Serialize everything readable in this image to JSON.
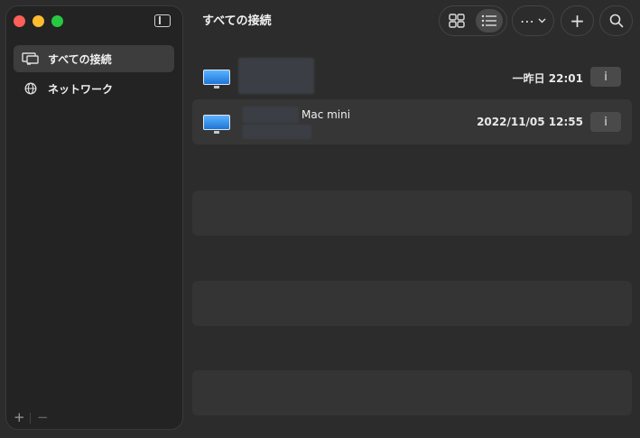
{
  "window": {
    "title": "すべての接続"
  },
  "sidebar": {
    "items": [
      {
        "label": "すべての接続",
        "icon": "display-icon",
        "active": true
      },
      {
        "label": "ネットワーク",
        "icon": "globe-icon",
        "active": false
      }
    ],
    "add_label": "+",
    "remove_label": "−"
  },
  "toolbar": {
    "grid_view": "grid-icon",
    "list_view": "list-icon",
    "more_label": "⋯",
    "add_label": "+",
    "search_icon": "search-icon"
  },
  "connections": [
    {
      "name": "",
      "time": "一昨日 22:01",
      "info_label": "i"
    },
    {
      "name": "Mac mini",
      "time": "2022/11/05 12:55",
      "info_label": "i"
    }
  ],
  "colors": {
    "accent": "#4a4a4a",
    "close": "#fe5f57",
    "minimize": "#febc2e",
    "zoom": "#28c840"
  }
}
